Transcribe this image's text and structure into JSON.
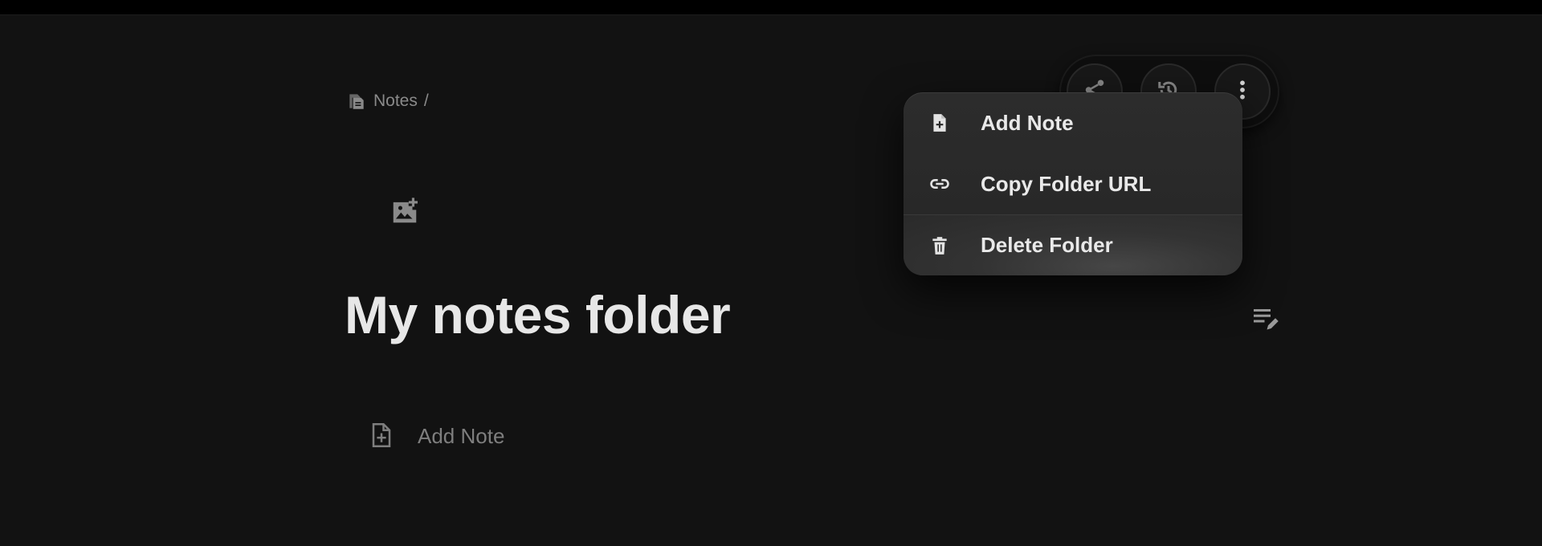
{
  "breadcrumb": {
    "root_label": "Notes",
    "separator": "/",
    "icon": "notes-stack-icon"
  },
  "cover": {
    "icon": "add-image-icon"
  },
  "folder": {
    "title": "My notes folder"
  },
  "edit_description": {
    "icon": "edit-description-icon"
  },
  "add_note_row": {
    "label": "Add Note",
    "icon": "add-note-icon"
  },
  "toolbar": {
    "buttons": [
      {
        "icon": "share-icon"
      },
      {
        "icon": "history-icon"
      },
      {
        "icon": "more-vertical-icon"
      }
    ]
  },
  "menu": {
    "items": [
      {
        "label": "Add Note",
        "icon": "add-note-icon"
      },
      {
        "label": "Copy Folder URL",
        "icon": "link-icon"
      },
      {
        "label": "Delete Folder",
        "icon": "trash-icon"
      }
    ]
  },
  "colors": {
    "background": "#121212",
    "text_primary": "#e7e7e7",
    "text_muted": "#8a8a8a",
    "menu_bg": "#2a2a2a"
  }
}
